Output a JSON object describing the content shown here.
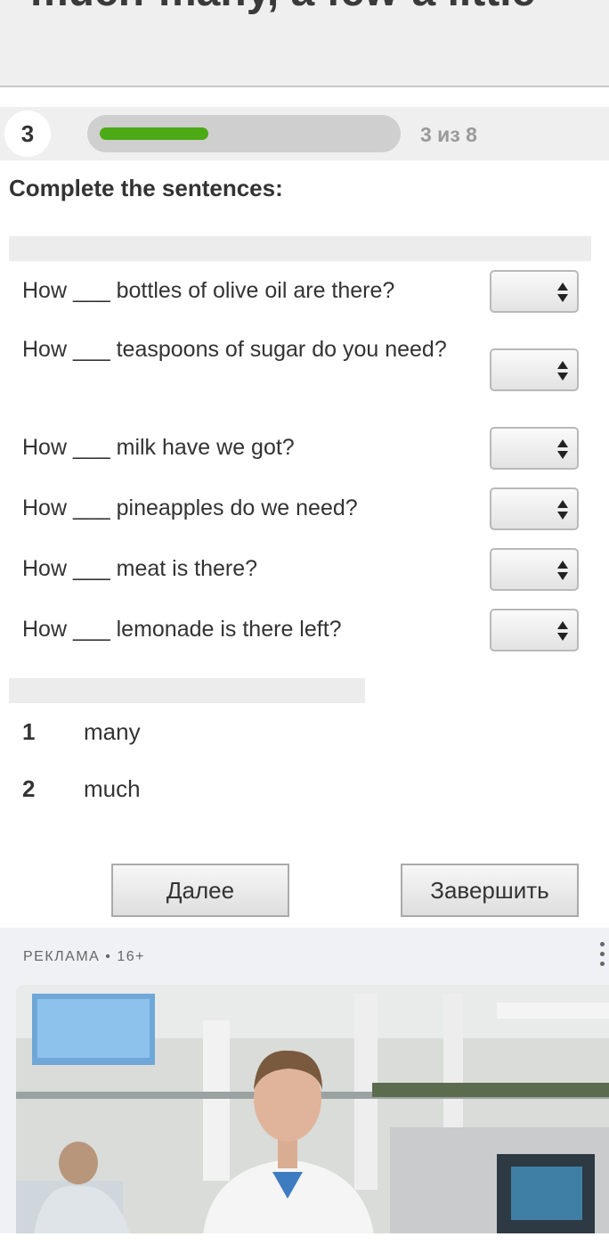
{
  "header": {
    "title": "much-many, a few-a little"
  },
  "progress": {
    "number": "3",
    "text": "3 из 8",
    "fraction": 0.375,
    "color": "#4caa14"
  },
  "instruction": "Complete the sentences:",
  "sentences": [
    {
      "text": "How ___ bottles of olive oil are there?"
    },
    {
      "text": "How ___ teaspoons of sugar do you need?"
    },
    {
      "text": "How ___ milk have we got?"
    },
    {
      "text": "How ___ pineapples do we need?"
    },
    {
      "text": "How ___ meat is there?"
    },
    {
      "text": "How ___ lemonade is there left?"
    }
  ],
  "answers": [
    {
      "number": "1",
      "word": "many"
    },
    {
      "number": "2",
      "word": "much"
    }
  ],
  "buttons": {
    "next": "Далее",
    "finish": "Завершить"
  },
  "ad": {
    "label": "РЕКЛАМА • 16+",
    "menu_icon": "more-vertical-icon"
  }
}
